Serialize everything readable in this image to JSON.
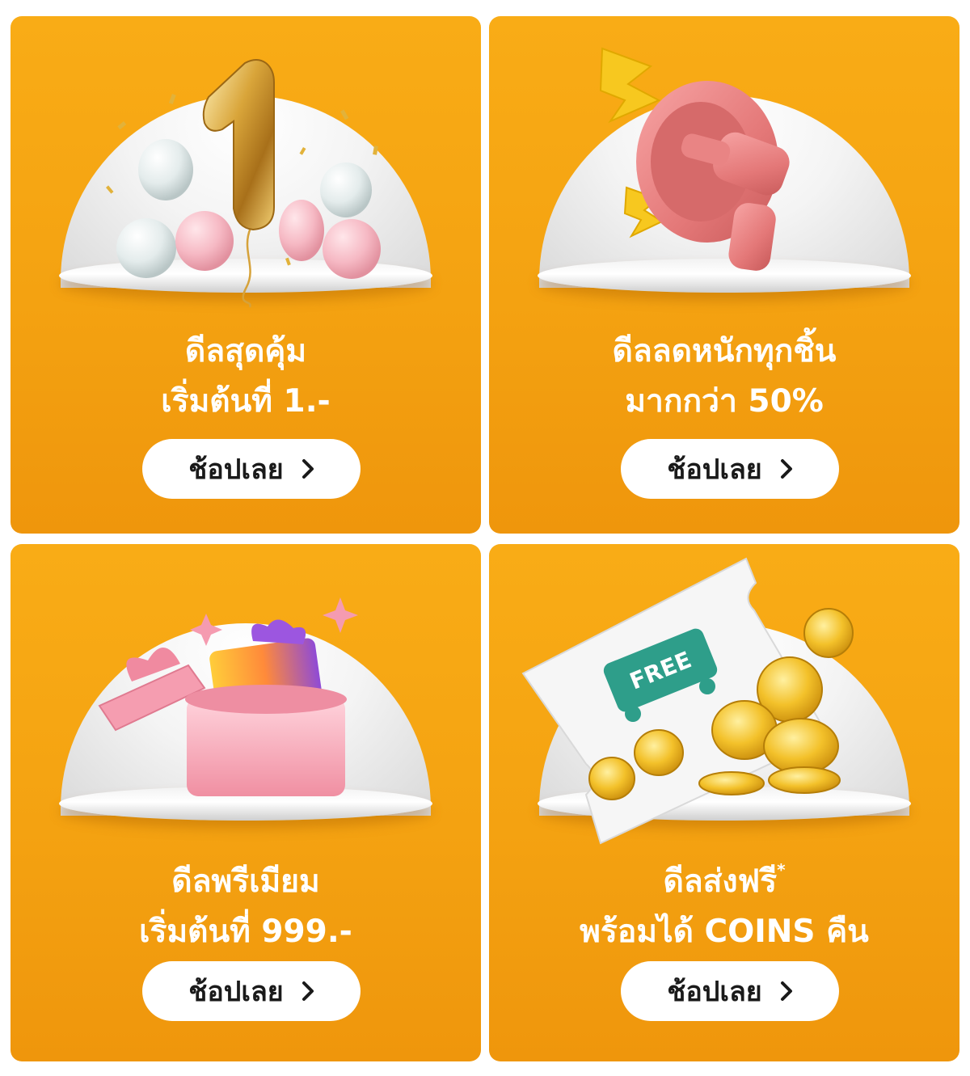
{
  "cards": [
    {
      "id": "deal-1-baht",
      "line1": "ดีลสุดคุ้ม",
      "line2": "เริ่มต้นที่ 1.-",
      "button_label": "ช้อปเลย",
      "illustration_text": "1",
      "illustration": "balloons-number-one"
    },
    {
      "id": "deal-50-percent",
      "line1": "ดีลลดหนักทุกชิ้น",
      "line2": "มากกว่า 50%",
      "button_label": "ช้อปเลย",
      "illustration": "megaphone"
    },
    {
      "id": "deal-premium",
      "line1": "ดีลพรีเมียม",
      "line2": "เริ่มต้นที่ 999.-",
      "button_label": "ช้อปเลย",
      "illustration": "gift-box"
    },
    {
      "id": "deal-free-shipping",
      "line1": "ดีลส่งฟรี",
      "line1_mark": "*",
      "line2": "พร้อมได้ COINS คืน",
      "button_label": "ช้อปเลย",
      "illustration_text": "FREE",
      "illustration": "free-shipping-coupon-coins"
    }
  ],
  "colors": {
    "card_bg": "#f4a211",
    "button_bg": "#ffffff",
    "title_text": "#ffffff",
    "button_text": "#1a1a1a",
    "truck_badge": "#2e9e8a"
  }
}
